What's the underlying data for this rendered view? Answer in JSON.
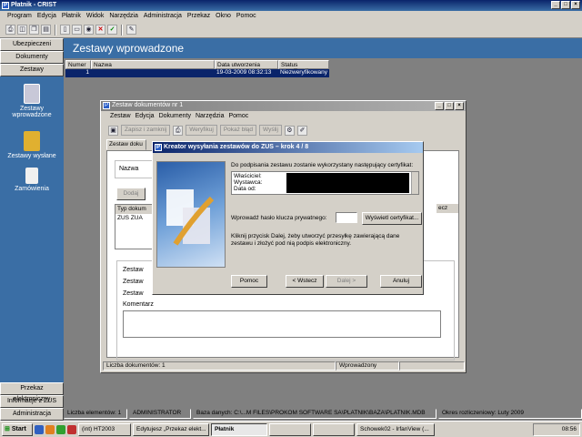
{
  "app": {
    "title": "Płatnik - CRIST"
  },
  "menu": [
    "Program",
    "Edycja",
    "Płatnik",
    "Widok",
    "Narzędzia",
    "Administracja",
    "Przekaz",
    "Okno",
    "Pomoc"
  ],
  "side": {
    "top_buttons": [
      "Ubezpieczeni",
      "Dokumenty",
      "Zestawy"
    ],
    "items": [
      "Zestawy wprowadzone",
      "Zestawy wysłane",
      "Zamówienia"
    ],
    "bottom_buttons": [
      "Przekaz elektroniczny",
      "Informacje z ZUS",
      "Administracja"
    ]
  },
  "main": {
    "title": "Zestawy wprowadzone",
    "columns": [
      "Numer",
      "Nazwa",
      "Data utworzenia",
      "Status weryfikacji"
    ],
    "row": {
      "numer": "1",
      "nazwa": "",
      "data": "19-03-2009 08:32:13",
      "status": "Niezweryfikowany"
    }
  },
  "child": {
    "title": "Zestaw dokumentów nr 1",
    "menu": [
      "Zestaw",
      "Edycja",
      "Dokumenty",
      "Narzędzia",
      "Pomoc"
    ],
    "toolbar": [
      "Zapisz i zamknij",
      "Weryfikuj",
      "Pokaż błąd",
      "Wyślij"
    ],
    "tab": "Zestaw doku",
    "name_label": "Nazwa",
    "add_button": "Dodaj",
    "doc_type_header": "Typ dokum",
    "doc_type_value": "ZUS ZUA",
    "right_col_header": "ecz",
    "zestaw_rows": [
      "Zestaw",
      "Zestaw",
      "Zestaw"
    ],
    "comment_label": "Komentarz",
    "status": {
      "count": "Liczba dokumentów: 1",
      "state": "Wprowadzony"
    }
  },
  "wizard": {
    "title": "Kreator wysyłania zestawów do ZUS – krok 4 / 8",
    "intro": "Do podpisania zestawu zostanie wykorzystany następujący certyfikat:",
    "cert_labels": [
      "Właściciel:",
      "Wystawca:",
      "Data od:"
    ],
    "pw_label": "Wprowadź hasło klucza prywatnego:",
    "show_cert": "Wyświetl certyfikat...",
    "info": "Kliknij przycisk Dalej, żeby utworzyć przesyłkę zawierającą dane zestawu i złożyć pod nią podpis elektroniczny.",
    "buttons": {
      "help": "Pomoc",
      "back": "< Wstecz",
      "next": "Dalej >",
      "cancel": "Anuluj"
    }
  },
  "statusbar": [
    "Liczba elementów: 1",
    "ADMINISTRATOR",
    "Baza danych: C:\\...M FILES\\PROKOM SOFTWARE SA\\PLATNIK\\BAZA\\PLATNIK.MDB",
    "Okres rozliczeniowy: Luty 2009"
  ],
  "taskbar": {
    "start": "Start",
    "tasks": [
      "(int) HT2003",
      "Edytujesz „Przekaz elekt...",
      "Płatnik",
      "",
      "",
      "Schowek02 - IrfanView (..."
    ],
    "clock": "08:56"
  }
}
